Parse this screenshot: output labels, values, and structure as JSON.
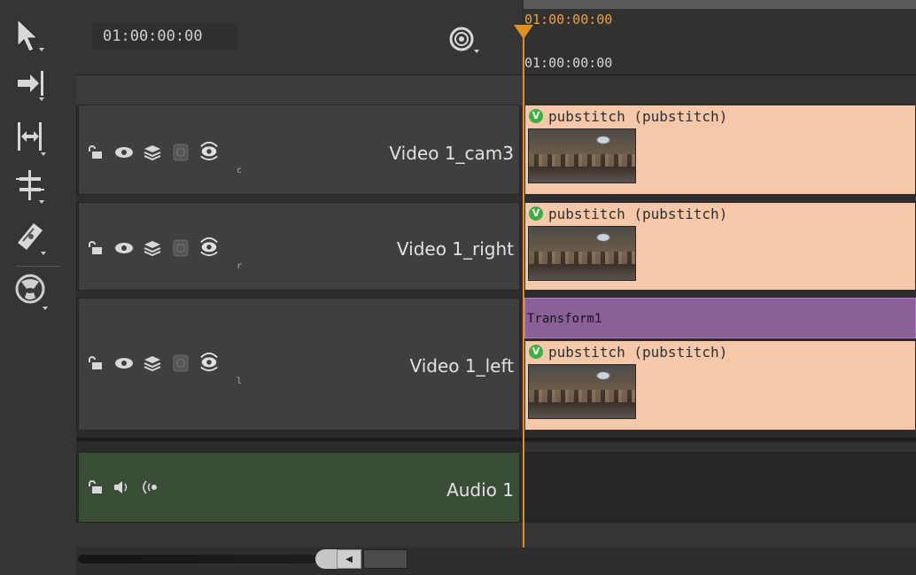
{
  "header": {
    "timecode": "01:00:00:00",
    "snap_icon": "snap-magnet-icon"
  },
  "ruler": {
    "playhead_timecode": "01:00:00:00",
    "start_timecode": "01:00:00:00",
    "playhead_color": "#e09020"
  },
  "tools": [
    {
      "name": "select-tool",
      "icon": "arrow-pointer-icon"
    },
    {
      "name": "track-select-tool",
      "icon": "arrow-to-line-icon"
    },
    {
      "name": "slip-tool",
      "icon": "bracket-range-icon"
    },
    {
      "name": "slide-tool",
      "icon": "trim-icon"
    },
    {
      "name": "razor-tool",
      "icon": "razor-blade-icon"
    },
    {
      "name": "multi-view-tool",
      "icon": "stereo-sphere-icon"
    }
  ],
  "video_tracks": [
    {
      "name": "Video 1_cam3",
      "view_hint": "c",
      "clip_title": "pubstitch (pubstitch)",
      "badge": "V"
    },
    {
      "name": "Video 1_right",
      "view_hint": "r",
      "clip_title": "pubstitch (pubstitch)",
      "badge": "V"
    },
    {
      "name": "Video 1_left",
      "view_hint": "l",
      "effect": "Transform1",
      "clip_title": "pubstitch (pubstitch)",
      "badge": "V"
    }
  ],
  "audio_tracks": [
    {
      "name": "Audio 1"
    }
  ],
  "colors": {
    "clip_fill": "#f6c8aa",
    "effect_fill": "#8a6098",
    "audio_header": "#3a4d37",
    "version_badge": "#3cb043"
  }
}
